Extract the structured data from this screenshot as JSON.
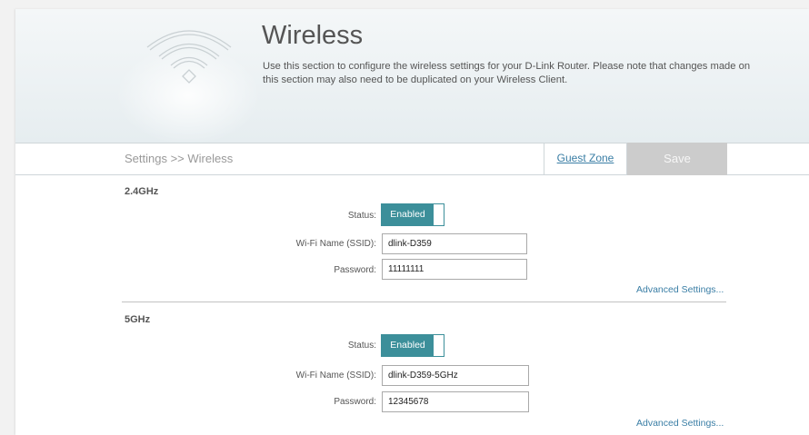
{
  "header": {
    "title": "Wireless",
    "description": "Use this section to configure the wireless settings for your D-Link Router. Please note that changes made on this section may also need to be duplicated on your Wireless Client.",
    "icon": "wifi-icon"
  },
  "nav": {
    "breadcrumb": "Settings >> Wireless",
    "guest_zone": "Guest Zone",
    "save": "Save"
  },
  "band24": {
    "title": "2.4GHz",
    "status_label": "Status:",
    "status_value": "Enabled",
    "ssid_label": "Wi-Fi Name (SSID):",
    "ssid_value": "dlink-D359",
    "password_label": "Password:",
    "password_value": "11111111",
    "advanced": "Advanced Settings..."
  },
  "band5": {
    "title": "5GHz",
    "status_label": "Status:",
    "status_value": "Enabled",
    "ssid_label": "Wi-Fi Name (SSID):",
    "ssid_value": "dlink-D359-5GHz",
    "password_label": "Password:",
    "password_value": "12345678",
    "advanced": "Advanced Settings..."
  },
  "colors": {
    "accent": "#3c8f9a",
    "link": "#3a7ea5",
    "save_disabled": "#cccccc"
  }
}
